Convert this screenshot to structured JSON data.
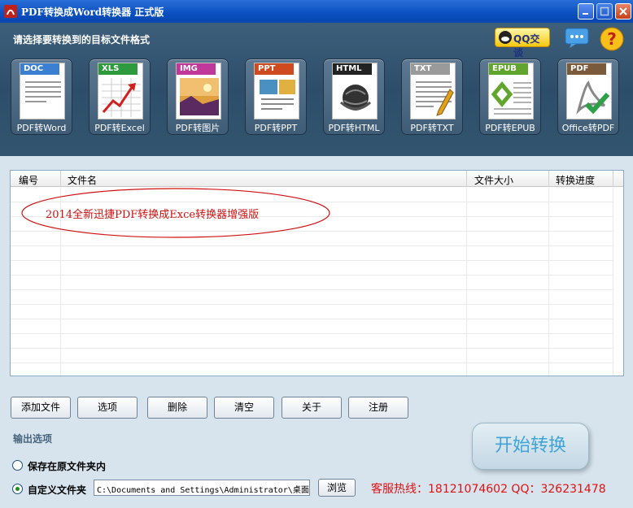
{
  "window": {
    "title": "PDF转换成Word转换器 正式版"
  },
  "header": {
    "prompt": "请选择要转换到的目标文件格式",
    "qq_label": "QQ交谈"
  },
  "formats": [
    {
      "tag": "DOC",
      "label": "PDF转Word",
      "color": "#3b7fd0"
    },
    {
      "tag": "XLS",
      "label": "PDF转Excel",
      "color": "#2e9a3e"
    },
    {
      "tag": "IMG",
      "label": "PDF转图片",
      "color": "#c0389a"
    },
    {
      "tag": "PPT",
      "label": "PDF转PPT",
      "color": "#d04a20"
    },
    {
      "tag": "HTML",
      "label": "PDF转HTML",
      "color": "#222222"
    },
    {
      "tag": "TXT",
      "label": "PDF转TXT",
      "color": "#9a9a9a"
    },
    {
      "tag": "EPUB",
      "label": "PDF转EPUB",
      "color": "#62a52e"
    },
    {
      "tag": "PDF",
      "label": "Office转PDF",
      "color": "#7a5a3a"
    }
  ],
  "list": {
    "columns": [
      "编号",
      "文件名",
      "文件大小",
      "转换进度"
    ],
    "banner": "2014全新迅捷PDF转换成Exce转换器增强版"
  },
  "buttons": {
    "add_file": "添加文件",
    "options": "选项",
    "delete": "删除",
    "clear": "清空",
    "about": "关于",
    "register": "注册"
  },
  "output": {
    "title": "输出选项",
    "save_original": "保存在原文件夹内",
    "custom_folder": "自定义文件夹",
    "path": "C:\\Documents and Settings\\Administrator\\桌面",
    "browse": "浏览"
  },
  "start": "开始转换",
  "hotline": "客服热线：18121074602 QQ：326231478"
}
